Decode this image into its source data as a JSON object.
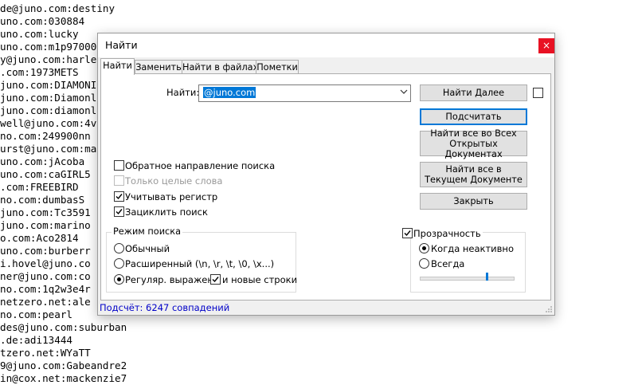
{
  "background_lines": [
    "de@juno.com:destiny",
    "uno.com:030884",
    "uno.com:lucky",
    "uno.com:m1p97000",
    "y@juno.com:harle",
    ".com:1973METS",
    "juno.com:DIAMONI",
    "juno.com:Diamonl",
    "juno.com:diamonl",
    "well@juno.com:4v",
    "no.com:249900nn",
    "urst@juno.com:ma",
    "uno.com:jAcoba",
    "uno.com:caGIRL5",
    ".com:FREEBIRD",
    "no.com:dumbasS",
    "juno.com:Tc3591",
    "juno.com:marino",
    "o.com:Aco2814",
    "uno.com:burberr",
    "i.hovel@juno.co",
    "ner@juno.com:co",
    "no.com:1q2w3e4r",
    "netzero.net:ale",
    "no.com:pearl",
    "des@juno.com:suburban",
    ".de:adi13444",
    "tzero.net:WYaTT",
    "9@juno.com:Gabeandre2",
    "in@cox.net:mackenzie7"
  ],
  "dialog": {
    "title": "Найти",
    "close_glyph": "×",
    "tabs": [
      "Найти",
      "Заменить",
      "Найти в файлах",
      "Пометки"
    ],
    "find_label": "Найти:",
    "find_value": "@juno.com",
    "buttons": {
      "find_next": "Найти Далее",
      "count": "Подсчитать",
      "find_all_open": [
        "Найти все во Всех",
        "Открытых Документах"
      ],
      "find_all_current": [
        "Найти все в",
        "Текущем Документе"
      ],
      "close": "Закрыть"
    },
    "options": {
      "backward": {
        "label": "Обратное направление поиска",
        "checked": false
      },
      "whole_word": {
        "label": "Только целые слова",
        "checked": false,
        "disabled": true
      },
      "match_case": {
        "label": "Учитывать регистр",
        "checked": true
      },
      "wrap": {
        "label": "Зациклить поиск",
        "checked": true
      }
    },
    "search_mode": {
      "title": "Режим поиска",
      "normal": "Обычный",
      "extended": "Расширенный (\\n, \\r, \\t, \\0, \\x...)",
      "regex": "Регуляр. выражен.",
      "newlines": "и новые строки",
      "selected": "regex",
      "newlines_checked": true
    },
    "transparency": {
      "title": "Прозрачность",
      "checked": true,
      "on_lose_focus": "Когда неактивно",
      "always": "Всегда",
      "selected": "on_lose_focus",
      "level": 0.72
    },
    "status": "Подсчёт: 6247 совпадений"
  }
}
